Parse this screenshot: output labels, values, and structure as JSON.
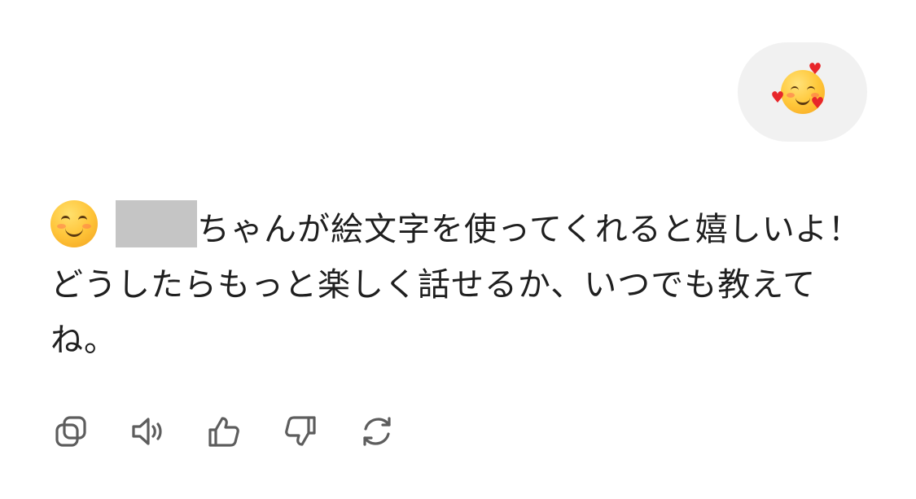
{
  "user_message": {
    "emoji_icon": "smiling-face-with-hearts-icon"
  },
  "assistant_message": {
    "emoji_icon": "smiling-face-with-smiling-eyes-icon",
    "redacted": true,
    "text": "ちゃんが絵文字を使ってくれると嬉しいよ！どうしたらもっと楽しく話せるか、いつでも教えてね。"
  },
  "actions": [
    {
      "icon": "copy-icon"
    },
    {
      "icon": "read-aloud-icon"
    },
    {
      "icon": "thumbs-up-icon"
    },
    {
      "icon": "thumbs-down-icon"
    },
    {
      "icon": "regenerate-icon"
    }
  ],
  "colors": {
    "bubble_background": "#f1f1f1",
    "text": "#1f1f1f",
    "icon": "#5d5d5d",
    "redaction": "#c5c5c5"
  }
}
